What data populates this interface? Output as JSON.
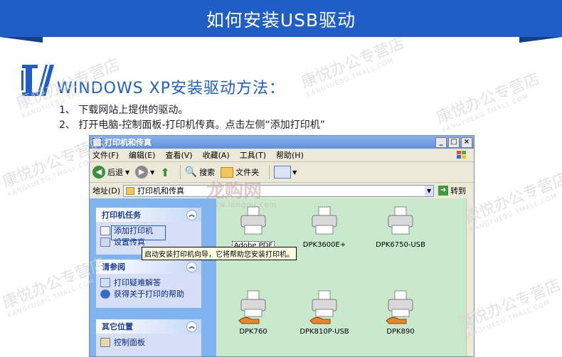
{
  "banner": {
    "title": "如何安装USB驱动",
    "color": "#1f5ec6"
  },
  "section": {
    "number": "1",
    "title": "WINDOWS XP安装驱动方法："
  },
  "steps": [
    "1、 下载网站上提供的驱动。",
    "2、 打开电脑-控制面板-打印机传真。点击左侧“添加打印机”"
  ],
  "window": {
    "title": "打印机和传真",
    "controls": {
      "minimize": "_",
      "maximize": "□",
      "close": "×"
    },
    "menu": [
      "文件(F)",
      "编辑(E)",
      "查看(V)",
      "收藏(A)",
      "工具(T)",
      "帮助(H)"
    ],
    "toolbar": {
      "back": "后退",
      "search": "搜索",
      "folders": "文件夹"
    },
    "address": {
      "label": "地址(D)",
      "value": "打印机和传真",
      "go": "转到"
    },
    "printer_tasks": {
      "header": "打印机任务",
      "items": [
        "添加打印机",
        "设置传真"
      ]
    },
    "tooltip": "启动安装打印机向导，它将帮助您安装打印机。",
    "see_also": {
      "header": "请参阅",
      "items": [
        "打印疑难解答",
        "获得关于打印的帮助"
      ]
    },
    "other_places": {
      "header": "其它位置",
      "items": [
        "控制面板"
      ]
    },
    "printers": [
      {
        "name": "Adobe PDF",
        "shared": false,
        "selected": true
      },
      {
        "name": "DPK3600E+",
        "shared": false,
        "selected": false
      },
      {
        "name": "DPK6750-USB",
        "shared": false,
        "selected": false
      },
      {
        "name": "DPK760",
        "shared": true,
        "selected": false
      },
      {
        "name": "DPK810P-USB",
        "shared": true,
        "selected": false
      },
      {
        "name": "DPK890",
        "shared": true,
        "selected": false
      }
    ]
  },
  "watermark": {
    "store": "康悦办公专营店",
    "domain": "KANGYUEBG.TMALL.COM"
  },
  "center_watermark": {
    "text": "龙购网",
    "url": "www.longou.com"
  }
}
